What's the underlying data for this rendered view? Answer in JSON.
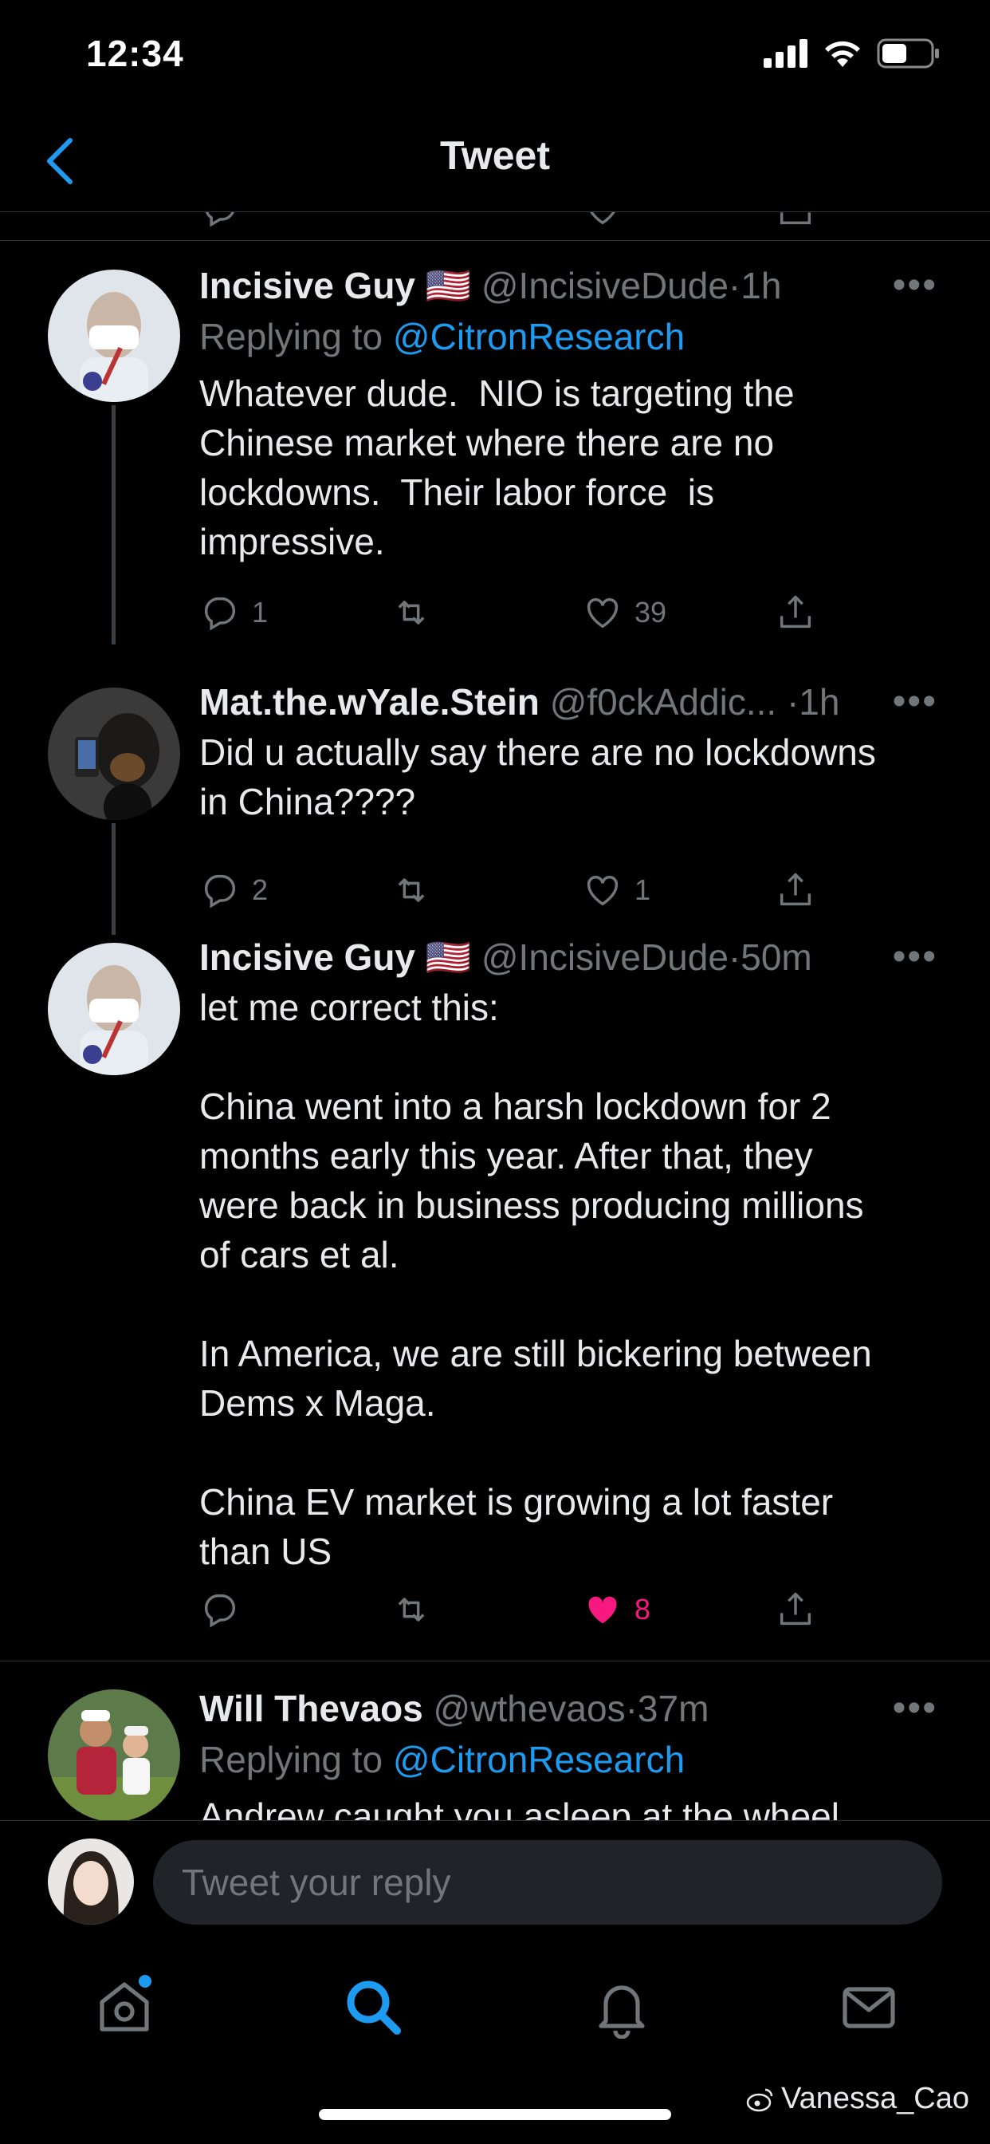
{
  "status_bar": {
    "time": "12:34"
  },
  "nav": {
    "title": "Tweet"
  },
  "tweets": [
    {
      "name": "Incisive Guy",
      "flag": "🇺🇸",
      "handle": "@IncisiveDude",
      "dot": "·",
      "time": "1h",
      "replying_prefix": "Replying to",
      "replying_to": "@CitronResearch",
      "body": "Whatever dude.  NIO is targeting the\nChinese market where there are no\nlockdowns.  Their labor force  is\nimpressive.",
      "replies": "1",
      "retweets": "",
      "likes": "39",
      "liked": false
    },
    {
      "name": "Mat.the.wYale.Stein",
      "handle": "@f0ckAddic...",
      "dot": "·",
      "time": "1h",
      "body": "Did u actually say there are no lockdowns\nin China????",
      "replies": "2",
      "retweets": "",
      "likes": "1",
      "liked": false
    },
    {
      "name": "Incisive Guy",
      "flag": "🇺🇸",
      "handle": "@IncisiveDude",
      "dot": "·",
      "time": "50m",
      "body": "let me correct this:\n\nChina went into a harsh lockdown for 2\nmonths early this year. After that, they\nwere back in business producing millions\nof cars et al.\n\nIn America, we are still bickering between\nDems x Maga.\n\nChina EV market is growing a lot faster\nthan US",
      "replies": "",
      "retweets": "",
      "likes": "8",
      "liked": true
    },
    {
      "name": "Will Thevaos",
      "handle": "@wthevaos",
      "dot": "·",
      "time": "37m",
      "replying_prefix": "Replying to",
      "replying_to": "@CitronResearch",
      "body": "Andrew caught you asleep at the wheel"
    }
  ],
  "more_glyph": "•••",
  "reply": {
    "placeholder": "Tweet your reply"
  },
  "tabs": [
    "home",
    "search",
    "notifications",
    "messages"
  ],
  "watermark": "Vanessa_Cao",
  "colors": {
    "accent": "#1d9bf0",
    "like": "#f91880",
    "muted": "#71767b",
    "background": "#000000"
  }
}
